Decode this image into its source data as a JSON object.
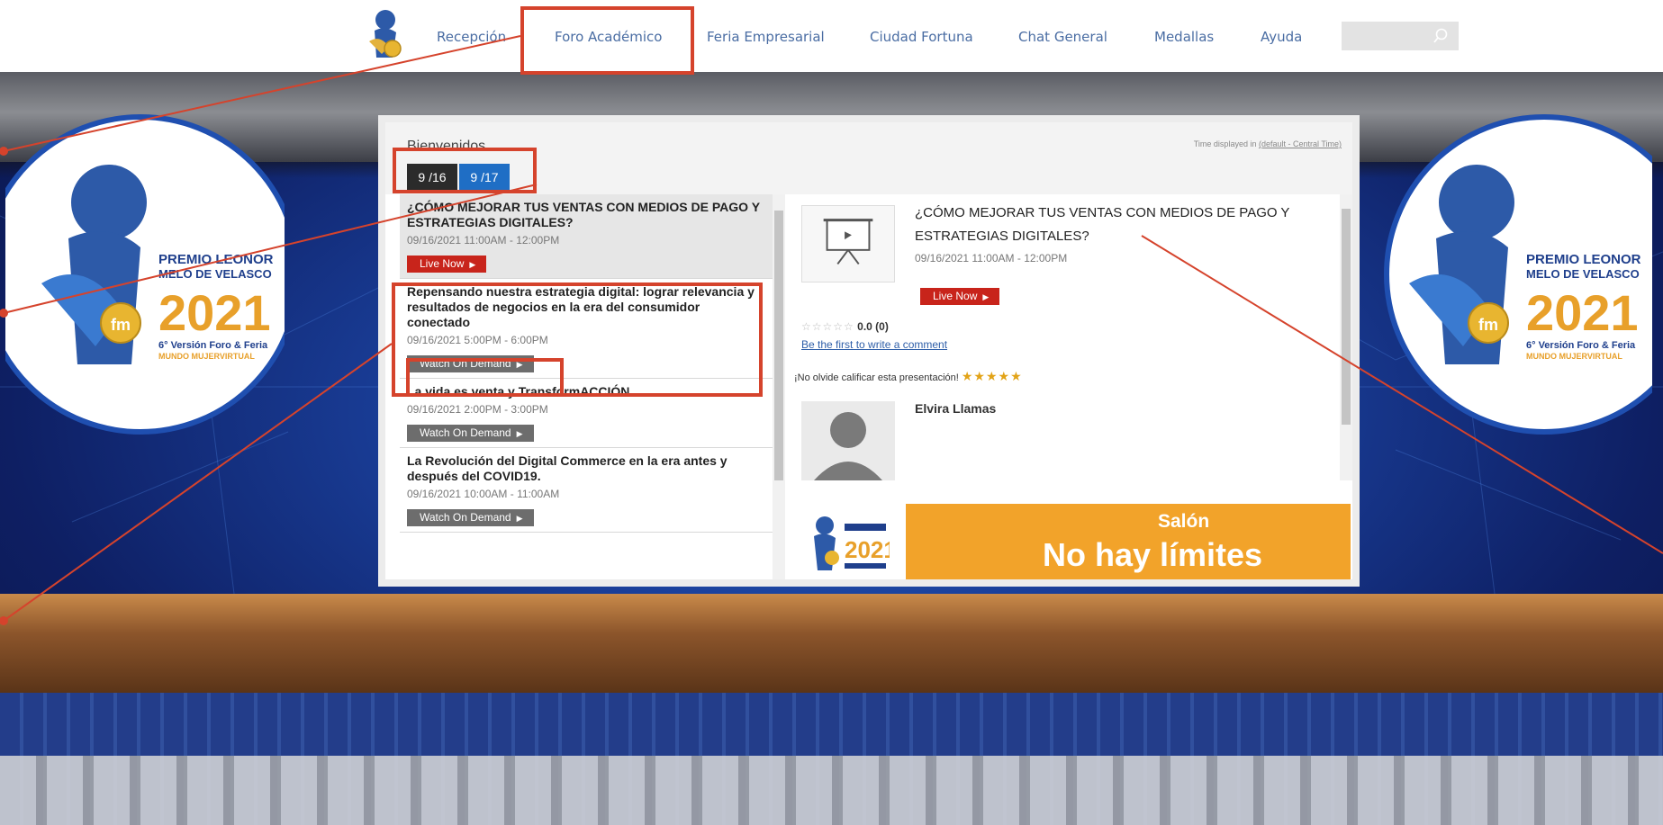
{
  "nav": {
    "items": [
      "Recepción",
      "Foro Académico",
      "Feria Empresarial",
      "Ciudad Fortuna",
      "Chat General",
      "Medallas",
      "Ayuda"
    ],
    "search_placeholder": ""
  },
  "badge": {
    "line1": "PREMIO LEONOR",
    "line2": "MELO DE VELASCO",
    "year": "2021",
    "line3": "6° Versión Foro & Feria",
    "line4": "MUNDO MUJERVIRTUAL",
    "mark": "fm"
  },
  "panel": {
    "welcome": "Bienvenidos",
    "tz_prefix": "Time displayed in ",
    "tz_link": "(default - Central Time)",
    "tabs": [
      "9 /16",
      "9 /17"
    ],
    "sessions": [
      {
        "title": "¿CÓMO MEJORAR TUS VENTAS CON MEDIOS DE PAGO Y ESTRATEGIAS DIGITALES?",
        "time": "09/16/2021 11:00AM - 12:00PM",
        "button": "Live Now"
      },
      {
        "title": "Repensando nuestra estrategia digital: lograr relevancia y resultados de negocios en la era del consumidor conectado",
        "time": "09/16/2021 5:00PM - 6:00PM",
        "button": "Watch On Demand"
      },
      {
        "title": "La vida es venta y TransformACCIÓN",
        "time": "09/16/2021 2:00PM - 3:00PM",
        "button": "Watch On Demand"
      },
      {
        "title": "La Revolución del Digital Commerce en la era antes y después del COVID19.",
        "time": "09/16/2021 10:00AM - 11:00AM",
        "button": "Watch On Demand"
      }
    ],
    "detail": {
      "title": "¿CÓMO MEJORAR TUS VENTAS CON MEDIOS DE PAGO Y ESTRATEGIAS DIGITALES?",
      "time": "09/16/2021 11:00AM - 12:00PM",
      "button": "Live Now",
      "stars_empty": "☆☆☆☆☆",
      "rating": "0.0 (0)",
      "comment_link": "Be the first to write a comment",
      "rate_prompt": "¡No olvide calificar esta presentación!",
      "rate_stars": "★★★★★",
      "speaker": "Elvira Llamas"
    },
    "banner": {
      "salon": "Salón",
      "text": "No hay límites"
    }
  },
  "colors": {
    "live_red": "#c8241b",
    "tab_blue": "#1f6ec5",
    "annotation_red": "#d5432c",
    "banner_orange": "#f2a32a"
  }
}
